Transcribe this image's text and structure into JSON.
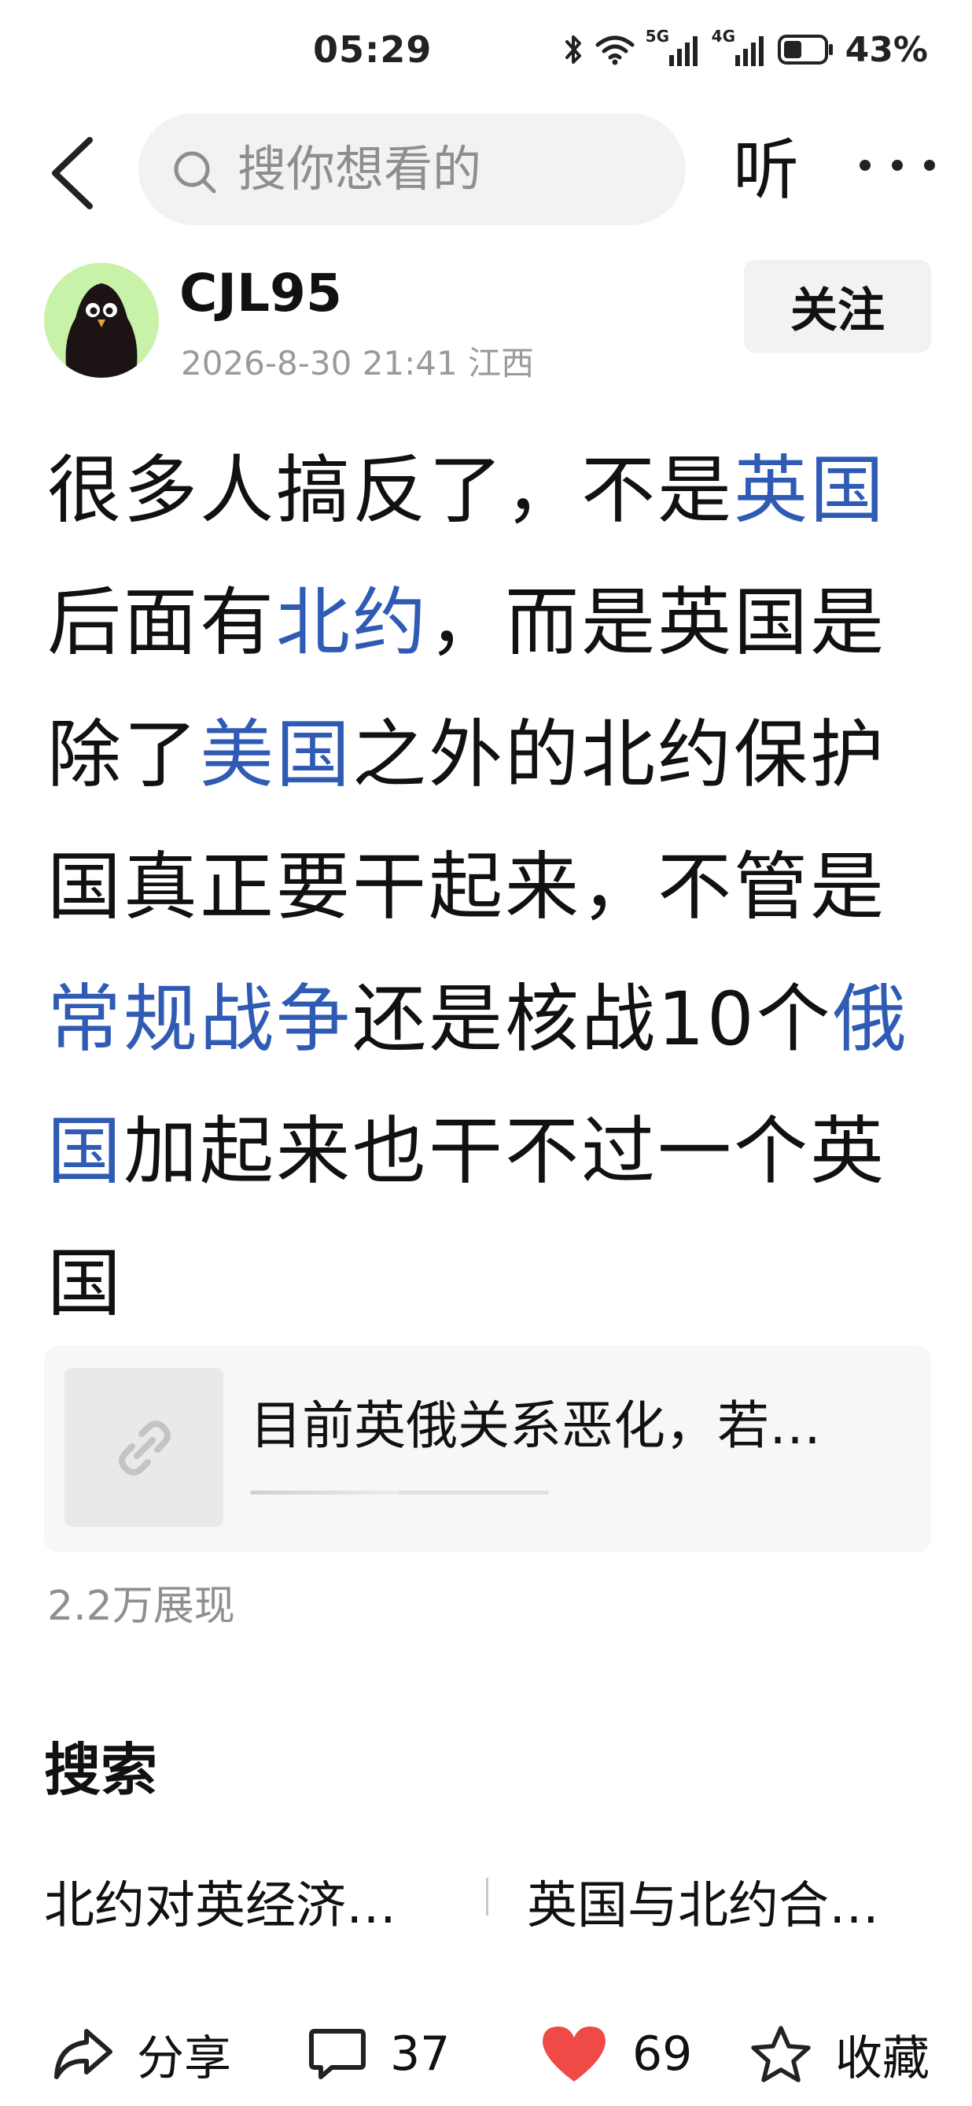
{
  "status_bar": {
    "time": "05:29",
    "network_1": "5G",
    "network_2": "4G",
    "battery": "43%",
    "icons": [
      "bluetooth-icon",
      "wifi-icon",
      "signal-icon",
      "battery-icon"
    ]
  },
  "nav": {
    "search_placeholder": "搜你想看的",
    "listen_label": "听"
  },
  "author": {
    "name": "CJL95",
    "meta": "2026-8-30 21:41 江西",
    "follow_label": "关注"
  },
  "post": {
    "segments": [
      {
        "text": "很多人搞反了，不是",
        "link": false
      },
      {
        "text": "英国",
        "link": true
      },
      {
        "text": "后面有",
        "link": false
      },
      {
        "text": "北约",
        "link": true
      },
      {
        "text": "，而是英国是除了",
        "link": false
      },
      {
        "text": "美国",
        "link": true
      },
      {
        "text": "之外的北约保护国真正要干起来，不管是",
        "link": false
      },
      {
        "text": "常规战争",
        "link": true
      },
      {
        "text": "还是核战10个",
        "link": false
      },
      {
        "text": "俄国",
        "link": true
      },
      {
        "text": "加起来也干不过一个英国",
        "link": false
      }
    ],
    "link_color": "#2f5bb5"
  },
  "link_card": {
    "title": "目前英俄关系恶化，若…",
    "progress": 0.5
  },
  "views": "2.2万展现",
  "search_section": {
    "heading": "搜索",
    "suggestions": [
      "北约对英经济…",
      "英国与北约合…"
    ]
  },
  "actions": {
    "share_label": "分享",
    "comment_count": "37",
    "like_count": "69",
    "fav_label": "收藏",
    "like_color": "#f04a46"
  }
}
